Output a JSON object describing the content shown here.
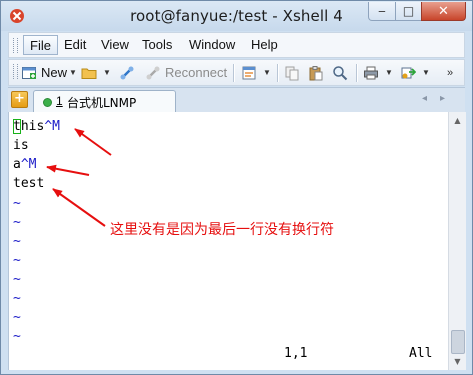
{
  "window": {
    "title": "root@fanyue:/test - Xshell 4",
    "close_glyph": "✕",
    "maximize_glyph": "□",
    "minimize_glyph": "‒"
  },
  "menu": {
    "items": [
      "File",
      "Edit",
      "View",
      "Tools",
      "Window",
      "Help"
    ],
    "active": "File"
  },
  "toolbar": {
    "new_label": "New",
    "reconnect_label": "Reconnect"
  },
  "tabs": {
    "items": [
      {
        "number": "1",
        "label": "台式机LNMP",
        "status_color": "#3cb04a"
      }
    ],
    "add_glyph": "+",
    "prev_glyph": "◂",
    "next_glyph": "▸"
  },
  "terminal": {
    "lines": [
      {
        "text": "this",
        "ctrl": "^M"
      },
      {
        "text": "is",
        "ctrl": ""
      },
      {
        "text": "a",
        "ctrl": "^M"
      },
      {
        "text": "test",
        "ctrl": ""
      }
    ],
    "tilde": "~",
    "status": {
      "position": "1,1",
      "scroll": "All"
    },
    "annotation": "这里没有是因为最后一行没有换行符",
    "colors": {
      "text": "#000000",
      "control_chars": "#1a1ac8",
      "annotation": "#e60f0f",
      "cursor": "#19b219"
    }
  }
}
